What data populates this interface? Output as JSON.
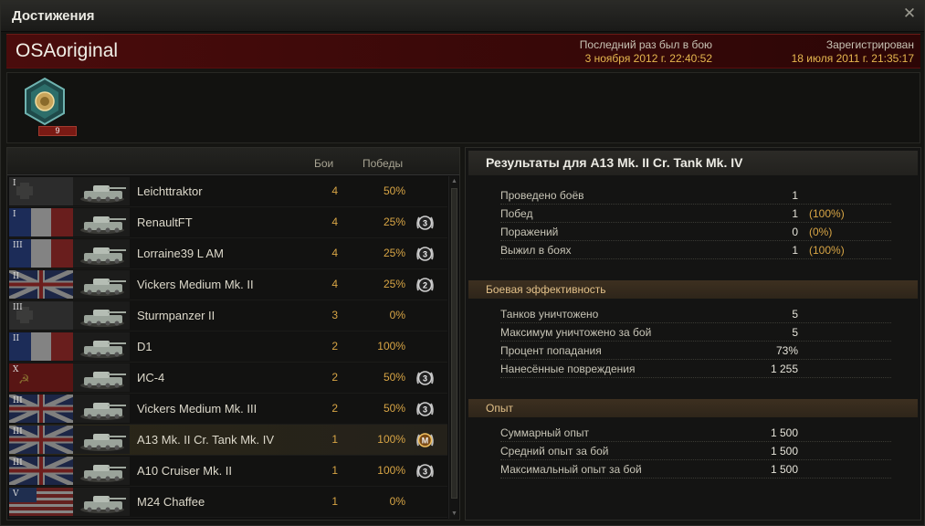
{
  "window": {
    "title": "Достижения",
    "close_label": "✕"
  },
  "header": {
    "player_name": "OSAoriginal",
    "last_battle_label": "Последний раз был в бою",
    "last_battle_value": "3 ноября 2012 г. 22:40:52",
    "registered_label": "Зарегистрирован",
    "registered_value": "18 июля 2011 г. 21:35:17"
  },
  "medals": {
    "count": "9"
  },
  "tank_list": {
    "col_battles": "Бои",
    "col_wins": "Победы",
    "rows": [
      {
        "tier": "I",
        "nation": "germany",
        "name": "Leichttraktor",
        "battles": "4",
        "wins": "50%",
        "badge": ""
      },
      {
        "tier": "I",
        "nation": "france",
        "name": "RenaultFT",
        "battles": "4",
        "wins": "25%",
        "badge": "3"
      },
      {
        "tier": "III",
        "nation": "france",
        "name": "Lorraine39 L AM",
        "battles": "4",
        "wins": "25%",
        "badge": "3"
      },
      {
        "tier": "II",
        "nation": "uk",
        "name": "Vickers Medium Mk. II",
        "battles": "4",
        "wins": "25%",
        "badge": "2"
      },
      {
        "tier": "III",
        "nation": "germany",
        "name": "Sturmpanzer II",
        "battles": "3",
        "wins": "0%",
        "badge": ""
      },
      {
        "tier": "II",
        "nation": "france",
        "name": "D1",
        "battles": "2",
        "wins": "100%",
        "badge": ""
      },
      {
        "tier": "X",
        "nation": "ussr",
        "name": "ИС-4",
        "battles": "2",
        "wins": "50%",
        "badge": "3"
      },
      {
        "tier": "III",
        "nation": "uk",
        "name": "Vickers Medium Mk. III",
        "battles": "2",
        "wins": "50%",
        "badge": "3"
      },
      {
        "tier": "III",
        "nation": "uk",
        "name": "A13 Mk. II Cr. Tank Mk. IV",
        "battles": "1",
        "wins": "100%",
        "badge": "M"
      },
      {
        "tier": "III",
        "nation": "uk",
        "name": "A10 Cruiser Mk. II",
        "battles": "1",
        "wins": "100%",
        "badge": "3"
      },
      {
        "tier": "V",
        "nation": "usa",
        "name": "M24 Chaffee",
        "battles": "1",
        "wins": "0%",
        "badge": ""
      }
    ]
  },
  "results": {
    "title": "Результаты для A13 Mk. II Cr. Tank Mk. IV",
    "general": [
      {
        "label": "Проведено боёв",
        "value": "1",
        "pct": ""
      },
      {
        "label": "Побед",
        "value": "1",
        "pct": "(100%)"
      },
      {
        "label": "Поражений",
        "value": "0",
        "pct": "(0%)"
      },
      {
        "label": "Выжил в боях",
        "value": "1",
        "pct": "(100%)"
      }
    ],
    "efficiency_title": "Боевая эффективность",
    "efficiency": [
      {
        "label": "Танков уничтожено",
        "value": "5"
      },
      {
        "label": "Максимум уничтожено за бой",
        "value": "5"
      },
      {
        "label": "Процент попадания",
        "value": "73%"
      },
      {
        "label": "Нанесённые повреждения",
        "value": "1 255"
      }
    ],
    "exp_title": "Опыт",
    "experience": [
      {
        "label": "Суммарный опыт",
        "value": "1 500"
      },
      {
        "label": "Средний опыт за бой",
        "value": "1 500"
      },
      {
        "label": "Максимальный опыт за бой",
        "value": "1 500"
      }
    ]
  },
  "colors": {
    "accent": "#d8a545",
    "header_red": "#4a0c0c",
    "section": "#3d3020"
  }
}
